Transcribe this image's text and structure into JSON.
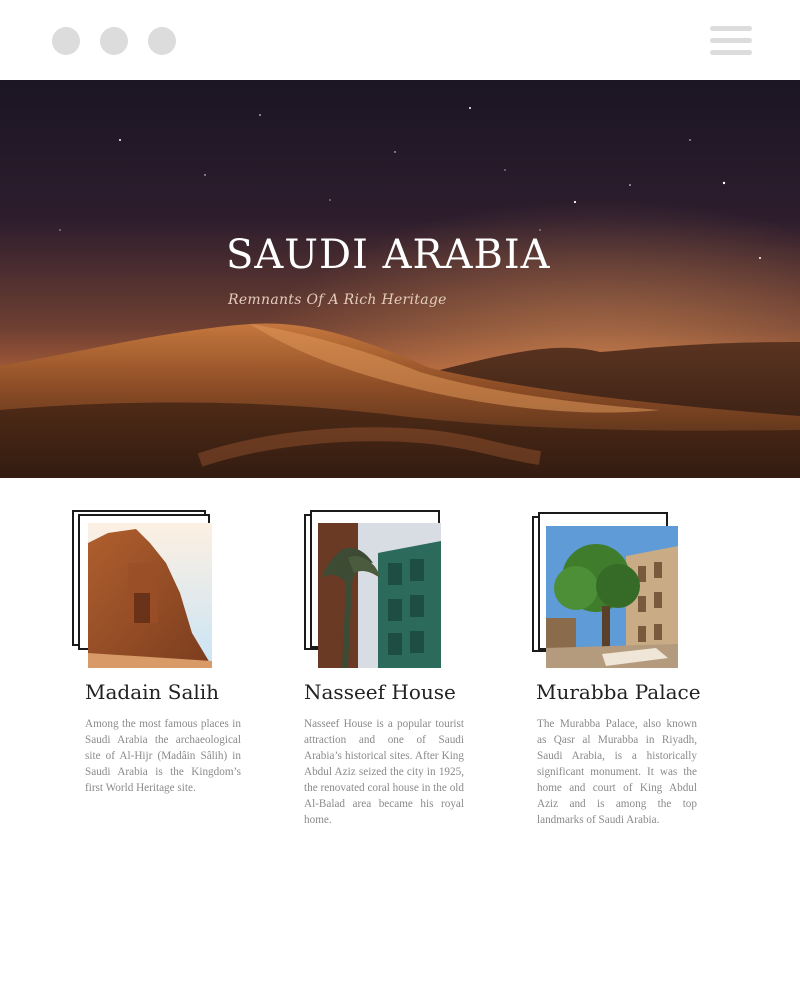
{
  "window_controls": {
    "dots": [
      "window-dot-1",
      "window-dot-2",
      "window-dot-3"
    ],
    "menu_icon": "hamburger-menu-icon"
  },
  "hero": {
    "title": "SAUDI ARABIA",
    "subtitle": "Remnants Of A Rich Heritage",
    "image": "desert-dunes-night-sky"
  },
  "cards": [
    {
      "title": "Madain Salih",
      "text": "Among the most famous places in Saudi Arabia the archaeological site of Al-Hijr (Madâin Sâlih) in Saudi Arabia is the Kingdom’s first World Heritage site.",
      "image": "madain-salih-rock-tomb"
    },
    {
      "title": "Nasseef House",
      "text": "Nasseef House is a popular tourist attraction and one of Saudi Arabia’s historical sites. After King Abdul Aziz seized the city in 1925, the renovated coral house in the old Al-Balad area became his royal home.",
      "image": "nasseef-house-facade"
    },
    {
      "title": "Murabba Palace",
      "text": "The Murabba Palace, also known as Qasr al Murabba in Riyadh, Saudi Arabia, is a historically significant monument. It was the home and court of King Abdul Aziz and is among the top landmarks of Saudi Arabia.",
      "image": "murabba-palace-garden"
    }
  ],
  "colors": {
    "frame": "#1a1a1a",
    "title_text": "#222222",
    "body_text": "#8a8a8a",
    "window_dot": "#dcdcdc"
  }
}
